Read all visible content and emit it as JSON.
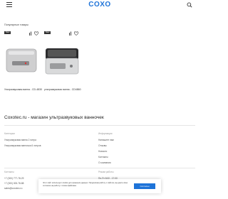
{
  "header": {
    "logo": "COXO",
    "menu_icon": "burger-icon",
    "search_icon": "search-icon"
  },
  "popular": {
    "title": "Популярные товары",
    "products": [
      {
        "badge": "New",
        "title": "Ультразвуковая ванна - CD-4830"
      },
      {
        "badge": "New",
        "title": "ультразвуковая ванна - CD4860"
      }
    ]
  },
  "store": {
    "title": "Coxotec.ru - магазин ультразвуковых ванночек"
  },
  "footer": {
    "categories": {
      "head": "Категории",
      "items": [
        "Ультразвуковая ванна 2 литра",
        "Ультразвуковая ванночка 6 литров"
      ]
    },
    "info": {
      "head": "Информация",
      "items": [
        "Напишите нам",
        "Отзывы",
        "Новости",
        "Контакты",
        "О компании"
      ]
    },
    "contacts": {
      "head": "Контакты",
      "items": [
        "+7 (000) 777-78-29",
        "+7 (000) 000-78-88",
        "sales@coxotec.ru"
      ]
    },
    "hours": {
      "head": "Режим работы",
      "value": "Пн-Пт 8:00 - 17:00"
    }
  },
  "cookie": {
    "text": "Этот сайт использует cookie для хранения данных. Продолжая работу с сайтом, вы даете свое согласие на работу с этими файлами.",
    "button": "Согласен"
  },
  "colors": {
    "brand": "#1e73d8"
  }
}
